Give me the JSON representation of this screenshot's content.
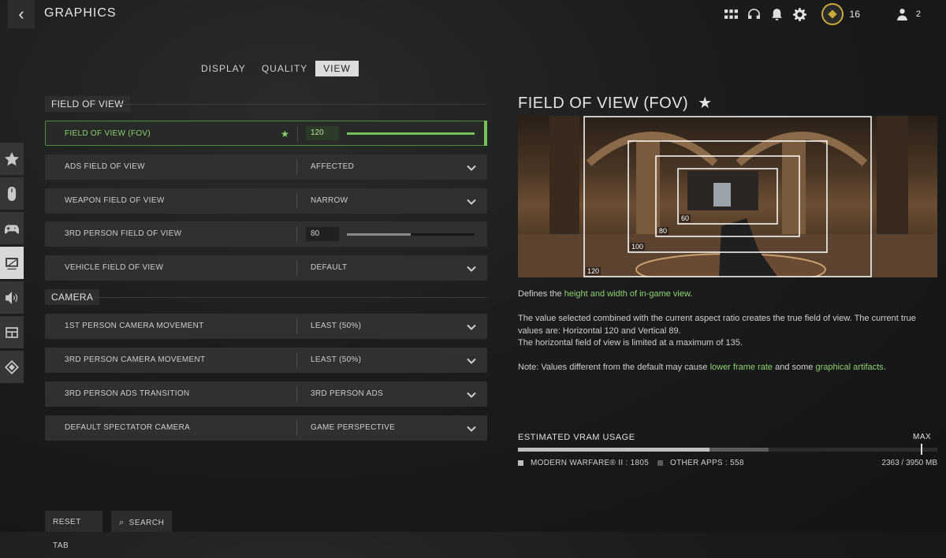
{
  "header": {
    "title": "GRAPHICS",
    "level": "16",
    "friends_online": "2"
  },
  "subtabs": [
    {
      "label": "DISPLAY",
      "active": false
    },
    {
      "label": "QUALITY",
      "active": false
    },
    {
      "label": "VIEW",
      "active": true
    }
  ],
  "sections": {
    "fov": "FIELD OF VIEW",
    "camera": "CAMERA"
  },
  "settings": {
    "fov": {
      "label": "FIELD OF VIEW (FOV)",
      "value": "120",
      "slider_fraction": 1.0,
      "favorite": true
    },
    "ads_fov": {
      "label": "ADS FIELD OF VIEW",
      "value": "AFFECTED"
    },
    "weapon_fov": {
      "label": "WEAPON FIELD OF VIEW",
      "value": "NARROW"
    },
    "third_fov": {
      "label": "3RD PERSON FIELD OF VIEW",
      "value": "80",
      "slider_fraction": 0.5
    },
    "vehicle_fov": {
      "label": "VEHICLE FIELD OF VIEW",
      "value": "DEFAULT"
    },
    "first_cam": {
      "label": "1ST PERSON CAMERA MOVEMENT",
      "value": "LEAST (50%)"
    },
    "third_cam": {
      "label": "3RD PERSON CAMERA MOVEMENT",
      "value": "LEAST (50%)"
    },
    "third_ads": {
      "label": "3RD PERSON ADS TRANSITION",
      "value": "3RD PERSON ADS"
    },
    "spectator": {
      "label": "DEFAULT SPECTATOR CAMERA",
      "value": "GAME PERSPECTIVE"
    }
  },
  "detail": {
    "title": "FIELD OF VIEW (FOV)",
    "fov_labels": [
      "120",
      "100",
      "80",
      "60"
    ],
    "p1_prefix": "Defines the ",
    "p1_highlight": "height and width of in-game view",
    "p1_suffix": ".",
    "p2_line1": "The value selected combined with the current aspect ratio creates the true field of view. The current true values are: Horizontal 120 and Vertical 89.",
    "p2_line2": "The horizontal field of view is limited at a maximum of 135.",
    "p3_prefix": "Note: Values different from the default may cause ",
    "p3_hl1": "lower frame rate",
    "p3_mid": " and some ",
    "p3_hl2": "graphical artifacts",
    "p3_suffix": "."
  },
  "vram": {
    "label": "ESTIMATED VRAM USAGE",
    "max_label": "MAX",
    "mw_label": "MODERN WARFARE® II : 1805",
    "other_label": "OTHER APPS : 558",
    "total_label": "2363 / 3950 MB",
    "mw_mb": 1805,
    "other_mb": 558,
    "total_mb": 3950,
    "mw_color": "#bfbfbf",
    "other_color": "#5a5b5b"
  },
  "footer": {
    "reset": "RESET TAB",
    "search": "SEARCH"
  },
  "icons": [
    "back-arrow-icon",
    "grid-icon",
    "headset-icon",
    "bell-icon",
    "gear-icon",
    "level-badge-icon",
    "friends-icon",
    "star-icon",
    "mouse-icon",
    "controller-icon",
    "graphics-icon",
    "speaker-icon",
    "interface-icon",
    "network-icon",
    "chevron-down-icon",
    "search-icon"
  ],
  "colors": {
    "accent": "#76c25a",
    "accent_text": "#8fd16f"
  }
}
